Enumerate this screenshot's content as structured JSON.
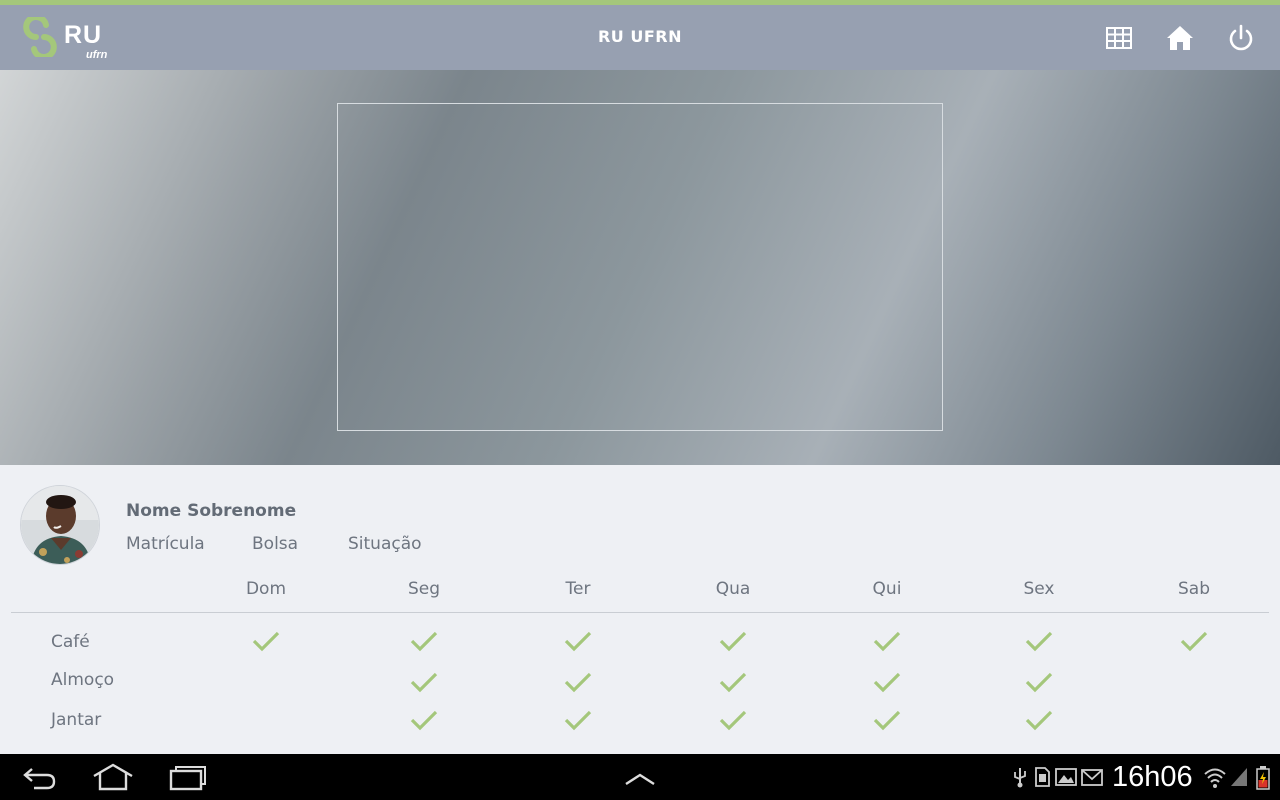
{
  "app": {
    "logo_text": "RU",
    "logo_subtext": "ufrn",
    "title": "RU UFRN",
    "accent_color": "#a4c77b",
    "bar_color": "#97a0b1"
  },
  "toolbar": {
    "icons": [
      "grid-icon",
      "home-icon",
      "power-icon"
    ]
  },
  "user": {
    "name": "Nome Sobrenome",
    "matricula_label": "Matrícula",
    "bolsa_label": "Bolsa",
    "situacao_label": "Situação"
  },
  "schedule": {
    "days": [
      "Dom",
      "Seg",
      "Ter",
      "Qua",
      "Qui",
      "Sex",
      "Sab"
    ],
    "meals": [
      {
        "label": "Café",
        "checks": [
          true,
          true,
          true,
          true,
          true,
          true,
          true
        ]
      },
      {
        "label": "Almoço",
        "checks": [
          false,
          true,
          true,
          true,
          true,
          true,
          false
        ]
      },
      {
        "label": "Jantar",
        "checks": [
          false,
          true,
          true,
          true,
          true,
          true,
          false
        ]
      }
    ]
  },
  "status_bar": {
    "time": "16h06",
    "icons": [
      "usb-icon",
      "sd-card-icon",
      "gallery-icon",
      "mail-icon",
      "wifi-icon",
      "signal-icon",
      "battery-icon"
    ]
  }
}
